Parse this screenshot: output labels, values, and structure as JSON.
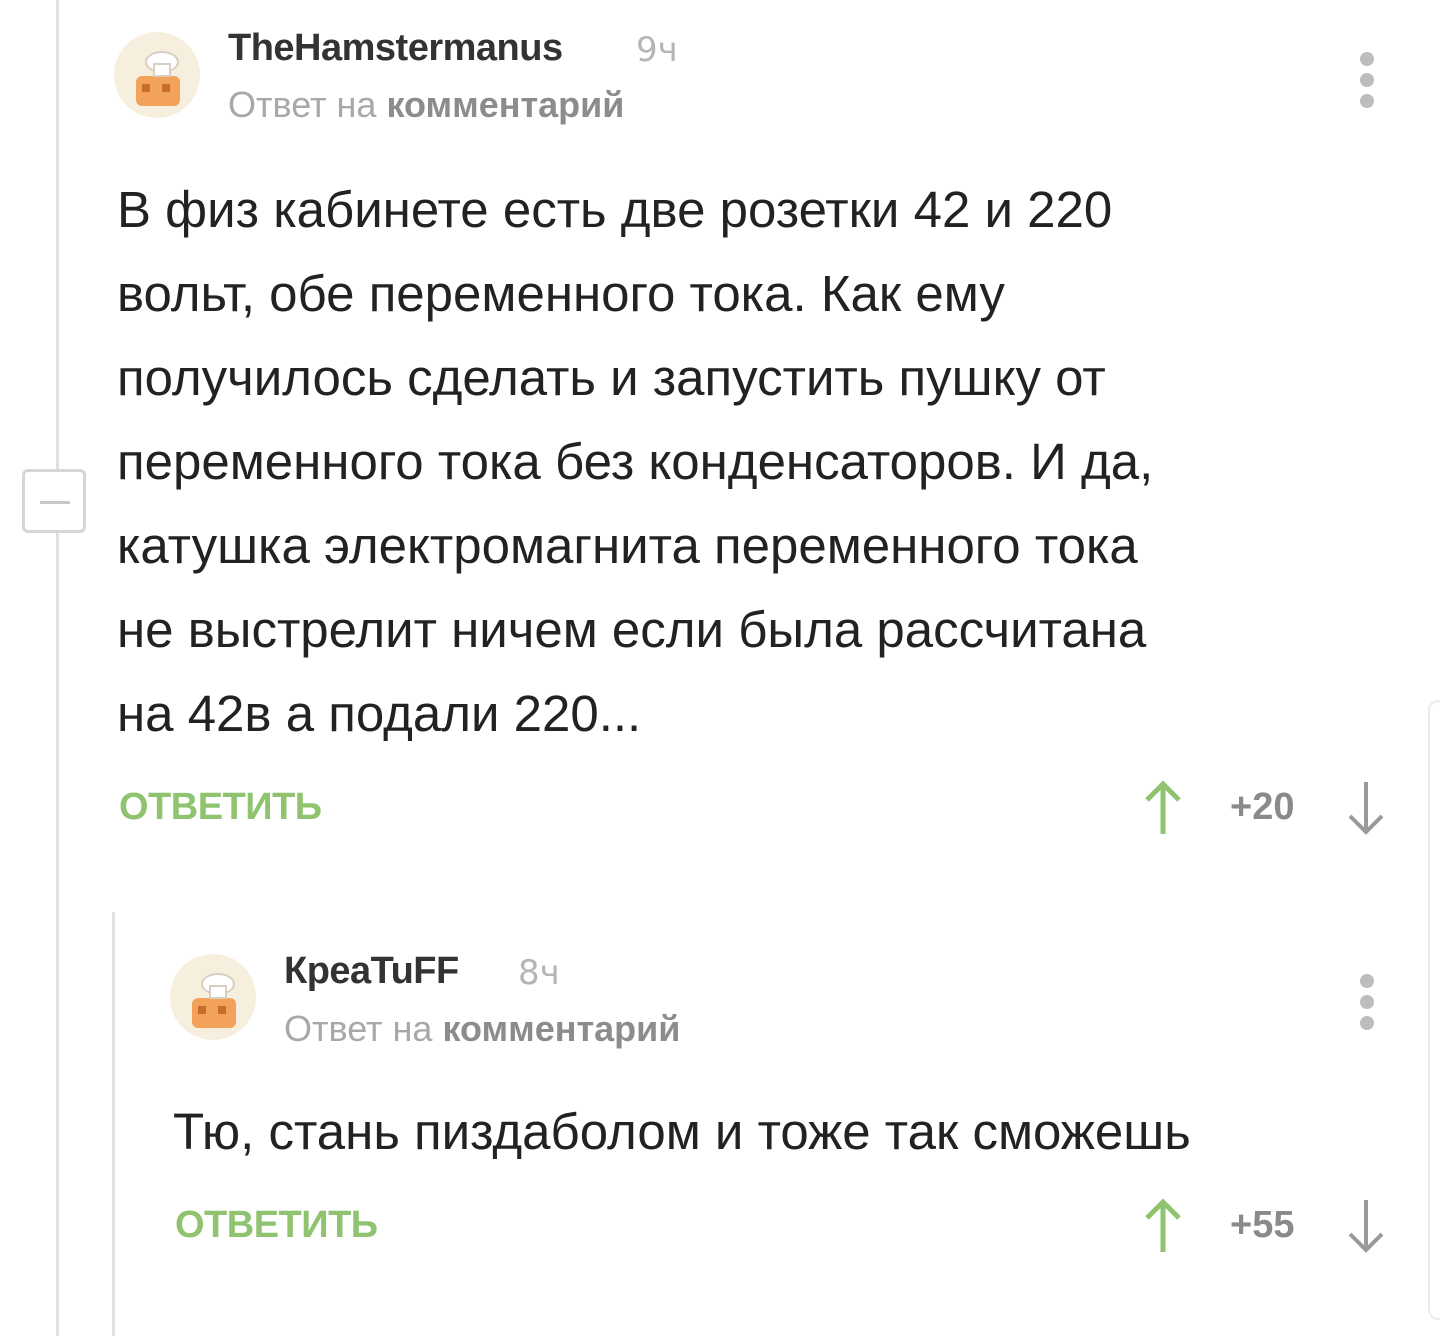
{
  "comments": [
    {
      "username": "TheHamstermanus",
      "time": "9ч",
      "reply_prefix": "Ответ на ",
      "reply_link": "комментарий",
      "text": "В физ кабинете есть две розетки 42 и 220\nвольт, обе переменного тока. Как ему\nполучилось сделать и запустить пушку от\nпеременного тока без конденсаторов. И да,\nкатушка электромагнита переменного тока\nне выстрелит ничем если была рассчитана\nна 42в а подали 220...",
      "reply_label": "ОТВЕТИТЬ",
      "rating": "+20"
    },
    {
      "username": "КреаTuFF",
      "time": "8ч",
      "reply_prefix": "Ответ на ",
      "reply_link": "комментарий",
      "text": "Тю, стань пиздаболом и тоже так сможешь",
      "reply_label": "ОТВЕТИТЬ",
      "rating": "+55"
    }
  ],
  "icons": {
    "avatar": "default-avatar-icon",
    "menu": "more-vertical-icon",
    "vote_up": "arrow-up-icon",
    "vote_down": "arrow-down-icon",
    "collapse": "minus-icon"
  },
  "colors": {
    "accent_green": "#8fc36f",
    "muted_text": "#a8a8a8",
    "thread_line": "#e0e0e0"
  }
}
